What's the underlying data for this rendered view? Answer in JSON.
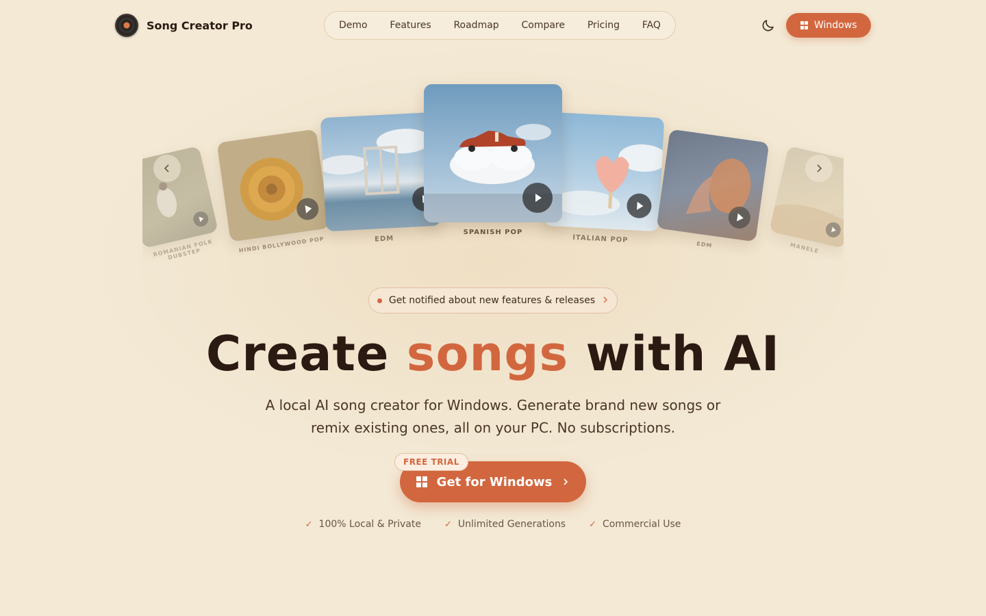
{
  "app": {
    "name": "Song Creator Pro"
  },
  "nav": {
    "links": [
      "Demo",
      "Features",
      "Roadmap",
      "Compare",
      "Pricing",
      "FAQ"
    ],
    "cta_label": "Windows",
    "theme_icon": "moon-icon"
  },
  "carousel": {
    "cards": [
      {
        "genre": "ROMANIAN FOLK DUBSTEP"
      },
      {
        "genre": "HINDI BOLLYWOOD POP"
      },
      {
        "genre": "EDM"
      },
      {
        "genre": "SPANISH POP"
      },
      {
        "genre": "ITALIAN POP"
      },
      {
        "genre": "EDM"
      },
      {
        "genre": "MANELE"
      }
    ]
  },
  "notify": {
    "text": "Get notified about new features & releases"
  },
  "hero": {
    "title_pre": "Create",
    "title_accent": "songs",
    "title_post": "with AI",
    "subtitle_line1": "A local AI song creator for Windows. Generate brand new songs or",
    "subtitle_line2": "remix existing ones, all on your PC. No subscriptions.",
    "badge": "FREE TRIAL",
    "cta_label": "Get for Windows"
  },
  "features": [
    "100% Local & Private",
    "Unlimited Generations",
    "Commercial Use"
  ],
  "colors": {
    "accent": "#d2673f",
    "background": "#f3e9d5",
    "text": "#2b1a12"
  }
}
